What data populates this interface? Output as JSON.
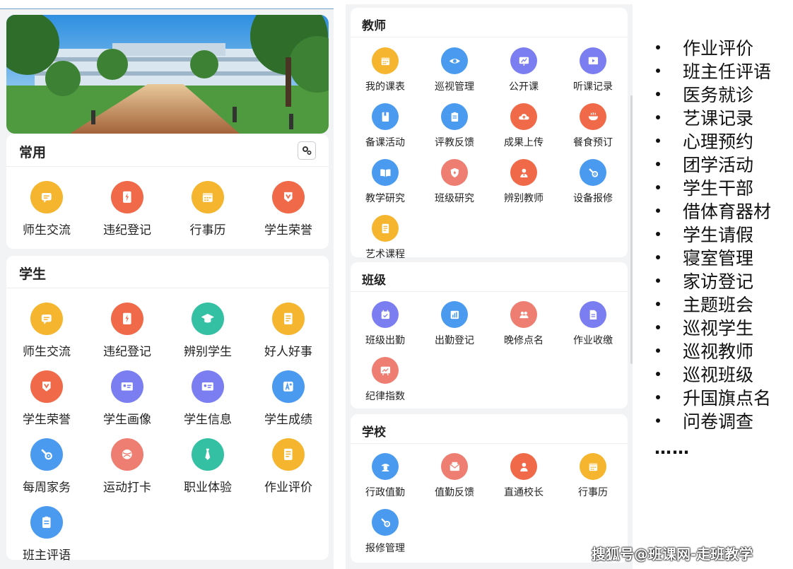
{
  "common": {
    "title": "常用",
    "settings_icon": "gear-icon",
    "items": [
      {
        "label": "师生交流",
        "icon": "chat-icon",
        "color": "#f5b52e"
      },
      {
        "label": "违纪登记",
        "icon": "notebook-flash-icon",
        "color": "#f06a4a"
      },
      {
        "label": "行事历",
        "icon": "calendar-icon",
        "color": "#f5b52e"
      },
      {
        "label": "学生荣誉",
        "icon": "medal-icon",
        "color": "#f06a4a"
      }
    ]
  },
  "student": {
    "title": "学生",
    "items": [
      {
        "label": "师生交流",
        "icon": "chat-icon",
        "color": "#f5b52e"
      },
      {
        "label": "违纪登记",
        "icon": "notebook-flash-icon",
        "color": "#f06a4a"
      },
      {
        "label": "辨别学生",
        "icon": "graduation-cap-icon",
        "color": "#34c0a3"
      },
      {
        "label": "好人好事",
        "icon": "notebook-icon",
        "color": "#f5b52e"
      },
      {
        "label": "学生荣誉",
        "icon": "medal-icon",
        "color": "#f06a4a"
      },
      {
        "label": "学生画像",
        "icon": "id-card-icon",
        "color": "#7b7ef0"
      },
      {
        "label": "学生信息",
        "icon": "id-card-icon",
        "color": "#7b7ef0"
      },
      {
        "label": "学生成绩",
        "icon": "grade-icon",
        "color": "#4a9af0"
      },
      {
        "label": "每周家务",
        "icon": "wrench-icon",
        "color": "#4a9af0"
      },
      {
        "label": "运动打卡",
        "icon": "ball-icon",
        "color": "#ee7e72"
      },
      {
        "label": "职业体验",
        "icon": "tie-icon",
        "color": "#34c0a3"
      },
      {
        "label": "作业评价",
        "icon": "notebook-icon",
        "color": "#f5b52e"
      },
      {
        "label": "班主评语",
        "icon": "clipboard-icon",
        "color": "#4a9af0"
      }
    ]
  },
  "teacher": {
    "title": "教师",
    "items": [
      {
        "label": "我的课表",
        "icon": "calendar-icon",
        "color": "#f5b52e"
      },
      {
        "label": "巡视管理",
        "icon": "eye-icon",
        "color": "#4a9af0"
      },
      {
        "label": "公开课",
        "icon": "presentation-icon",
        "color": "#7b7ef0"
      },
      {
        "label": "听课记录",
        "icon": "video-play-icon",
        "color": "#7b7ef0"
      },
      {
        "label": "备课活动",
        "icon": "book-icon",
        "color": "#4a9af0"
      },
      {
        "label": "评教反馈",
        "icon": "clipboard-icon",
        "color": "#4a9af0"
      },
      {
        "label": "成果上传",
        "icon": "cloud-upload-icon",
        "color": "#f06a4a"
      },
      {
        "label": "餐食预订",
        "icon": "bowl-icon",
        "color": "#f06a4a"
      },
      {
        "label": "教学研究",
        "icon": "open-book-icon",
        "color": "#4a9af0"
      },
      {
        "label": "班级研究",
        "icon": "shield-icon",
        "color": "#ee7e72"
      },
      {
        "label": "辨别教师",
        "icon": "teacher-icon",
        "color": "#f06a4a"
      },
      {
        "label": "设备报修",
        "icon": "wrench-icon",
        "color": "#4a9af0"
      },
      {
        "label": "艺术课程",
        "icon": "notebook-icon",
        "color": "#f5b52e"
      }
    ]
  },
  "class": {
    "title": "班级",
    "items": [
      {
        "label": "班级出勤",
        "icon": "calendar-check-icon",
        "color": "#7b7ef0"
      },
      {
        "label": "出勤登记",
        "icon": "bar-chart-icon",
        "color": "#4a9af0"
      },
      {
        "label": "晚修点名",
        "icon": "users-icon",
        "color": "#ee7e72"
      },
      {
        "label": "作业收缴",
        "icon": "document-icon",
        "color": "#7b7ef0"
      },
      {
        "label": "纪律指数",
        "icon": "trend-chart-icon",
        "color": "#ee7e72"
      }
    ]
  },
  "school": {
    "title": "学校",
    "items": [
      {
        "label": "行政值勤",
        "icon": "guard-icon",
        "color": "#4a9af0"
      },
      {
        "label": "值勤反馈",
        "icon": "mail-icon",
        "color": "#ee7e72"
      },
      {
        "label": "直通校长",
        "icon": "person-icon",
        "color": "#f06a4a"
      },
      {
        "label": "行事历",
        "icon": "calendar-icon",
        "color": "#f5b52e"
      },
      {
        "label": "报修管理",
        "icon": "wrench-icon",
        "color": "#4a9af0"
      }
    ]
  },
  "feature_list": {
    "items": [
      "作业评价",
      "班主任评语",
      "医务就诊",
      "艺课记录",
      "心理预约",
      "团学活动",
      "学生干部",
      "借体育器材",
      "学生请假",
      "寝室管理",
      "家访登记",
      "主题班会",
      "巡视学生",
      "巡视教师",
      "巡视班级",
      "升国旗点名",
      "问卷调查"
    ],
    "ellipsis": "……"
  },
  "watermark": "搜狐号@班课网-走班教学"
}
